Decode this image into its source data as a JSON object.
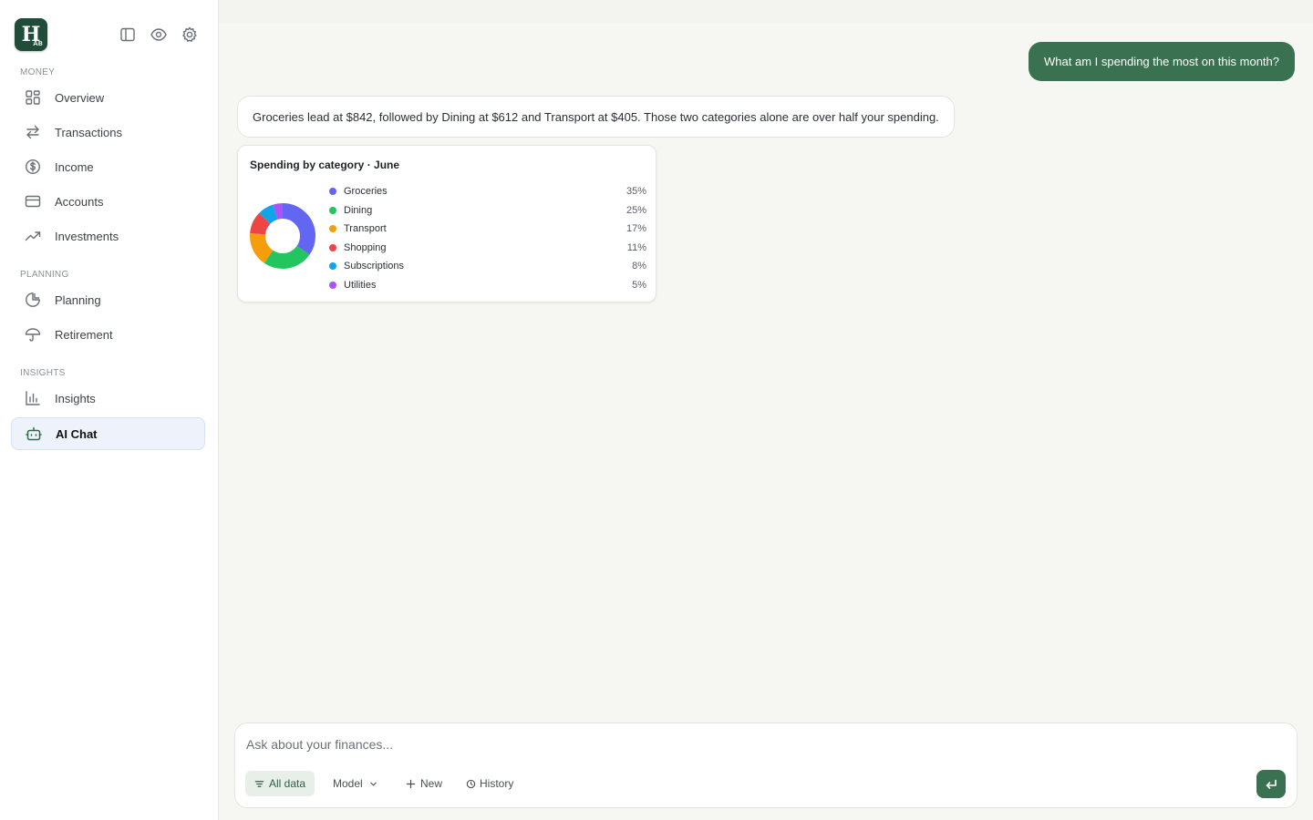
{
  "sidebar": {
    "logo": {
      "letter": "H",
      "sub": "AB"
    },
    "sections": [
      {
        "label": "MONEY",
        "items": [
          {
            "label": "Overview",
            "icon": "grid-icon"
          },
          {
            "label": "Transactions",
            "icon": "arrows-swap-icon"
          },
          {
            "label": "Income",
            "icon": "dollar-circle-icon"
          },
          {
            "label": "Accounts",
            "icon": "credit-card-icon"
          },
          {
            "label": "Investments",
            "icon": "trend-up-icon"
          }
        ]
      },
      {
        "label": "PLANNING",
        "items": [
          {
            "label": "Planning",
            "icon": "pie-icon"
          },
          {
            "label": "Retirement",
            "icon": "umbrella-icon"
          }
        ]
      },
      {
        "label": "INSIGHTS",
        "items": [
          {
            "label": "Insights",
            "icon": "bar-chart-icon"
          },
          {
            "label": "AI Chat",
            "icon": "robot-icon",
            "active": true
          }
        ]
      }
    ]
  },
  "chat": {
    "user_message": "What am I spending the most on this month?",
    "ai_message": "Groceries lead at $842, followed by Dining at $612 and Transport at $405. Those two categories alone are over half your spending."
  },
  "chart_data": {
    "type": "pie",
    "title": "Spending by category · June",
    "categories": [
      "Groceries",
      "Dining",
      "Transport",
      "Shopping",
      "Subscriptions",
      "Utilities"
    ],
    "values": [
      35,
      25,
      17,
      11,
      8,
      5
    ],
    "labels": [
      "35%",
      "25%",
      "17%",
      "11%",
      "8%",
      "5%"
    ],
    "colors": [
      "#6366f1",
      "#22c55e",
      "#f59e0b",
      "#ef4444",
      "#0ea5e9",
      "#a855f7"
    ],
    "donut": true
  },
  "composer": {
    "placeholder": "Ask about your finances...",
    "chips": {
      "all_data": "All data",
      "model": "Model",
      "new": "New",
      "history": "History"
    }
  },
  "colors": {
    "accent": "#3a7150",
    "active_nav_bg": "#eef2fb"
  }
}
